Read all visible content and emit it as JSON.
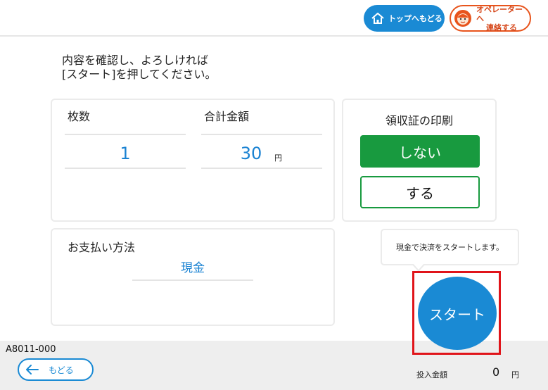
{
  "header": {
    "top_button_label": "トップへもどる",
    "operator_button_line1": "オペレーターへ",
    "operator_button_line2": "連絡する"
  },
  "instruction": {
    "line1": "内容を確認し、よろしければ",
    "line2": "[スタート]を押してください。"
  },
  "order": {
    "count_label": "枚数",
    "count_value": "1",
    "total_label": "合計金額",
    "total_value": "30",
    "total_unit": "円"
  },
  "receipt": {
    "title": "領収証の印刷",
    "no_label": "しない",
    "yes_label": "する"
  },
  "payment": {
    "label": "お支払い方法",
    "value": "現金"
  },
  "tooltip": {
    "text": "現金で決済をスタートします。"
  },
  "start_label": "スタート",
  "footer": {
    "screen_code": "A8011-000",
    "back_label": "もどる",
    "amount_label": "投入金額",
    "amount_value": "0",
    "amount_unit": "円"
  },
  "colors": {
    "primary_blue": "#1a8ad4",
    "receipt_green": "#189a3f",
    "operator_orange": "#e8541c",
    "highlight_red": "#e0141a"
  },
  "icons": {
    "home": "home-icon",
    "operator": "operator-face-icon",
    "back": "arrow-left-icon"
  }
}
